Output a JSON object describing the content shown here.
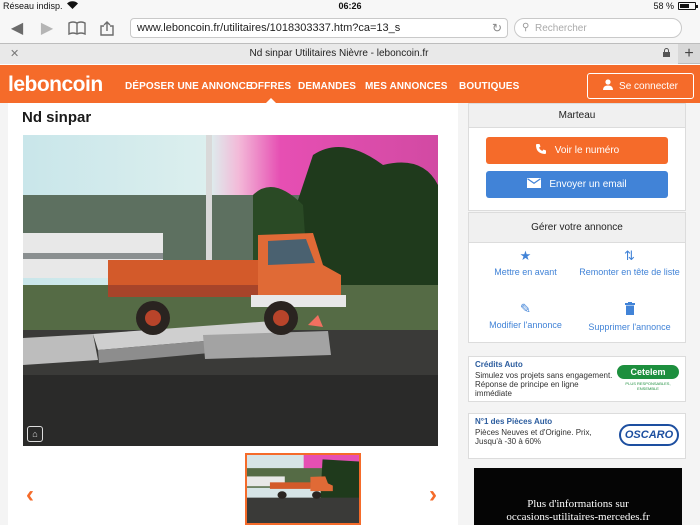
{
  "status_bar": {
    "carrier": "Réseau indisp.",
    "time": "06:26",
    "battery_text": "58 %",
    "battery_level": 0.58
  },
  "browser": {
    "url": "www.leboncoin.fr/utilitaires/1018303337.htm?ca=13_s",
    "search_placeholder": "Rechercher",
    "tab_title": "Nd sinpar Utilitaires Nièvre - leboncoin.fr"
  },
  "nav": {
    "logo": "leboncoin",
    "items": [
      "DÉPOSER UNE ANNONCE",
      "OFFRES",
      "DEMANDES",
      "MES ANNONCES",
      "BOUTIQUES"
    ],
    "active": "OFFRES",
    "connect_label": "Se connecter"
  },
  "listing": {
    "title": "Nd sinpar"
  },
  "seller": {
    "name": "Marteau",
    "call_label": "Voir le numéro",
    "email_label": "Envoyer un email"
  },
  "manage": {
    "title": "Gérer votre annonce",
    "items": [
      "Mettre en avant",
      "Remonter en tête de liste",
      "Modifier l'annonce",
      "Supprimer l'annonce"
    ]
  },
  "ads": [
    {
      "title": "Crédits Auto",
      "text": "Simulez vos projets sans engagement. Réponse de principe en ligne immédiate",
      "logo": "Cetelem",
      "logo_sub": "PLUS RESPONSABLES, ENSEMBLE"
    },
    {
      "title": "N°1 des Pièces Auto",
      "text": "Pièces Neuves et d'Origine. Prix, Jusqu'à -30 à 60%",
      "logo": "OSCARO"
    }
  ],
  "banner": {
    "line1": "Plus d'informations sur",
    "line2": "occasions-utilitaires-mercedes.fr"
  },
  "colors": {
    "brand_orange": "#f56b2a",
    "link_blue": "#4183d7"
  }
}
